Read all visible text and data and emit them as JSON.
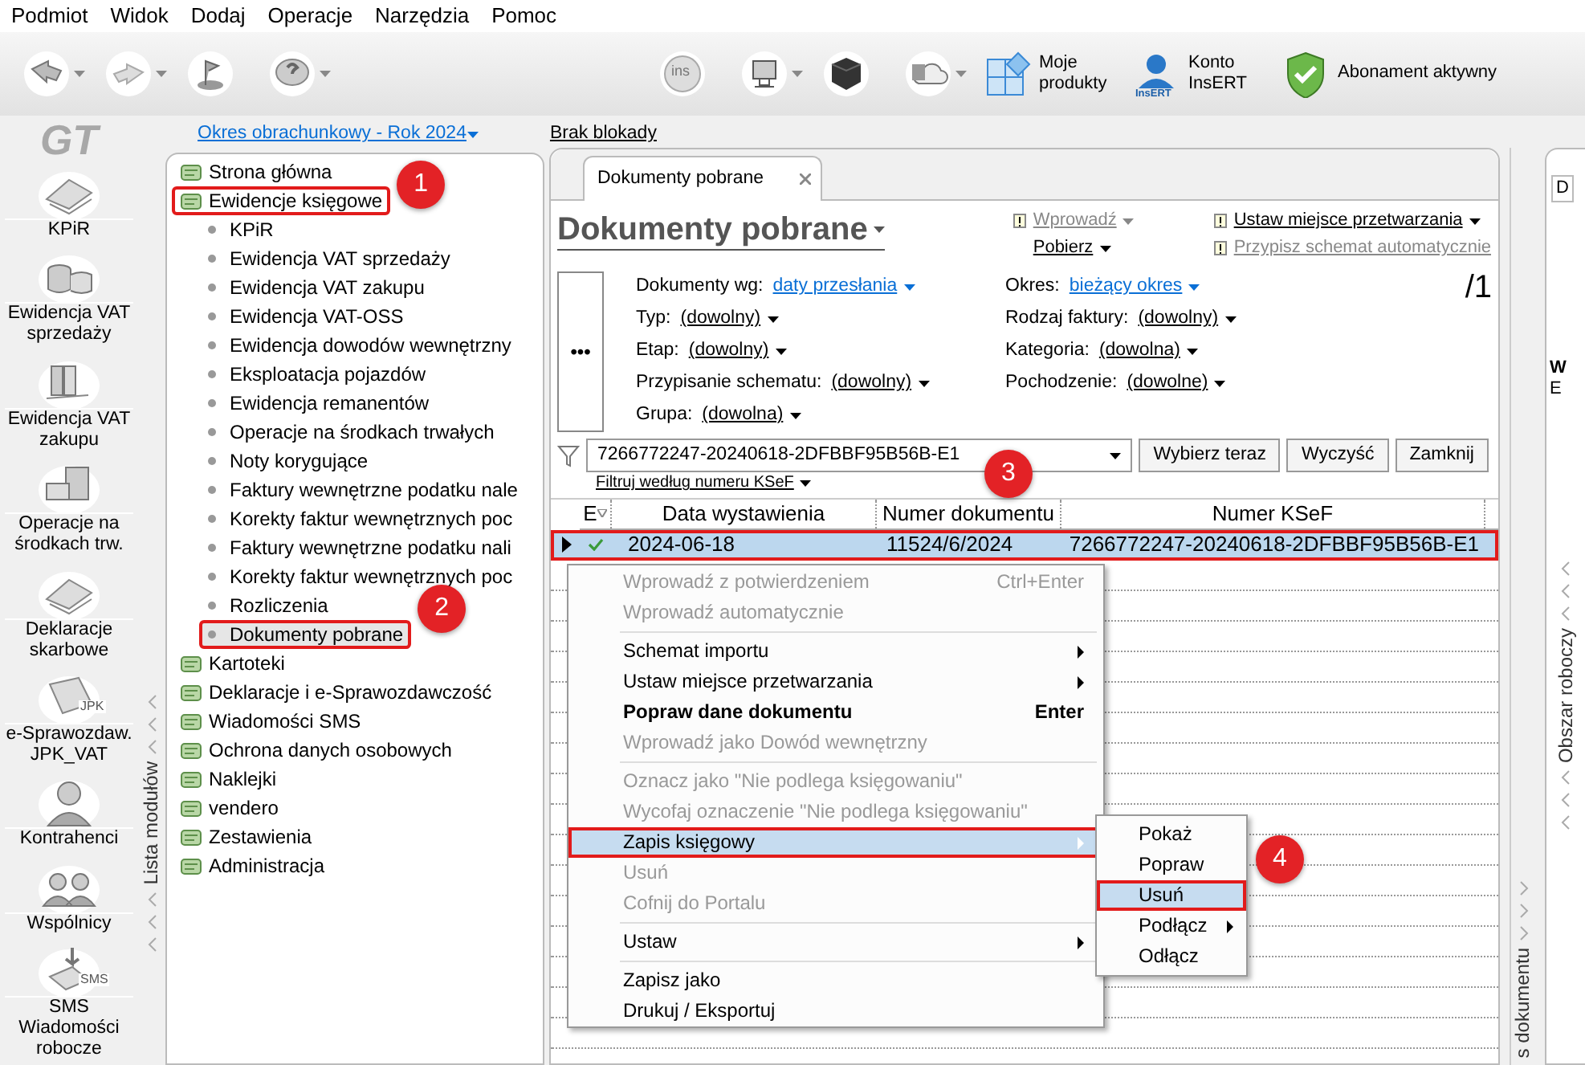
{
  "menu_bar": [
    {
      "label": "Podmiot"
    },
    {
      "label": "Widok"
    },
    {
      "label": "Dodaj"
    },
    {
      "label": "Operacje"
    },
    {
      "label": "Narzędzia"
    },
    {
      "label": "Pomoc"
    }
  ],
  "toolbar": {
    "buttons": [
      {
        "kind": "back",
        "has_menu": true
      },
      {
        "kind": "forward",
        "has_menu": true
      },
      {
        "kind": "flag",
        "has_menu": false
      },
      {
        "kind": "help",
        "has_menu": true
      },
      {
        "kind": "ins",
        "text": "ins",
        "has_menu": false
      },
      {
        "kind": "monitor",
        "has_menu": true
      },
      {
        "kind": "cube",
        "has_menu": false
      },
      {
        "kind": "cloud",
        "has_menu": true
      }
    ],
    "links": [
      {
        "kind": "products",
        "label": "Moje produkty"
      },
      {
        "kind": "account",
        "label": "Konto InsERT",
        "icon_text": "InsERT"
      },
      {
        "kind": "subscription",
        "label": "Abonament aktywny"
      }
    ]
  },
  "logo": "GT",
  "period": "Okres obrachunkowy - Rok 2024",
  "lock": "Brak blokady",
  "modules": [
    {
      "kind": "papers",
      "label": "KPiR"
    },
    {
      "kind": "coins",
      "label": "Ewidencja VAT sprzedaży"
    },
    {
      "kind": "binders",
      "label": "Ewidencja VAT zakupu"
    },
    {
      "kind": "cabinet",
      "label": "Operacje na środkach trw."
    },
    {
      "kind": "papers",
      "label": "Deklaracje skarbowe"
    },
    {
      "kind": "jpk",
      "label": "e-Sprawozdaw. JPK_VAT",
      "icon_text": "JPK"
    },
    {
      "kind": "person",
      "label": "Kontrahenci"
    },
    {
      "kind": "people",
      "label": "Wspólnicy"
    },
    {
      "kind": "sms",
      "label": "SMS Wiadomości robocze",
      "icon_text": "SMS"
    }
  ],
  "module_list_label": "Lista modułów",
  "tree": [
    {
      "label": "Strona główna",
      "selected": false,
      "highlighted": false
    },
    {
      "label": "Ewidencje księgowe",
      "selected": false,
      "highlighted": true,
      "callout": "1",
      "children": [
        {
          "label": "KPiR",
          "selected": false,
          "highlighted": false
        },
        {
          "label": "Ewidencja VAT sprzedaży",
          "selected": false,
          "highlighted": false
        },
        {
          "label": "Ewidencja VAT zakupu",
          "selected": false,
          "highlighted": false
        },
        {
          "label": "Ewidencja VAT-OSS",
          "selected": false,
          "highlighted": false
        },
        {
          "label": "Ewidencja dowodów wewnętrzny",
          "selected": false,
          "highlighted": false
        },
        {
          "label": "Eksploatacja pojazdów",
          "selected": false,
          "highlighted": false
        },
        {
          "label": "Ewidencja remanentów",
          "selected": false,
          "highlighted": false
        },
        {
          "label": "Operacje na środkach trwałych",
          "selected": false,
          "highlighted": false
        },
        {
          "label": "Noty korygujące",
          "selected": false,
          "highlighted": false
        },
        {
          "label": "Faktury wewnętrzne podatku nale",
          "selected": false,
          "highlighted": false
        },
        {
          "label": "Korekty faktur wewnętrznych poc",
          "selected": false,
          "highlighted": false
        },
        {
          "label": "Faktury wewnętrzne podatku nali",
          "selected": false,
          "highlighted": false
        },
        {
          "label": "Korekty faktur wewnętrznych poc",
          "selected": false,
          "highlighted": false
        },
        {
          "label": "Rozliczenia",
          "selected": false,
          "highlighted": false
        },
        {
          "label": "Dokumenty pobrane",
          "selected": true,
          "highlighted": true,
          "callout": "2"
        }
      ]
    },
    {
      "label": "Kartoteki",
      "selected": false,
      "highlighted": false
    },
    {
      "label": "Deklaracje i e-Sprawozdawczość",
      "selected": false,
      "highlighted": false
    },
    {
      "label": "Wiadomości SMS",
      "selected": false,
      "highlighted": false
    },
    {
      "label": "Ochrona danych osobowych",
      "selected": false,
      "highlighted": false
    },
    {
      "label": "Naklejki",
      "selected": false,
      "highlighted": false
    },
    {
      "label": "vendero",
      "selected": false,
      "highlighted": false
    },
    {
      "label": "Zestawienia",
      "selected": false,
      "highlighted": false
    },
    {
      "label": "Administracja",
      "selected": false,
      "highlighted": false
    }
  ],
  "tabs": [
    {
      "label": "Dokumenty pobrane",
      "selected": true
    }
  ],
  "page_title": "Dokumenty pobrane",
  "action_groups": [
    {
      "items": [
        {
          "label": "Wprowadź",
          "disabled": true
        },
        {
          "label": "Pobierz",
          "disabled": false
        }
      ]
    },
    {
      "items": [
        {
          "label": "Ustaw miejsce przetwarzania",
          "disabled": false
        },
        {
          "label": "Przypisz schemat automatycznie",
          "disabled": true
        }
      ]
    }
  ],
  "page_counter": "/1",
  "more_button": "•••",
  "filter_groups": [
    {
      "items": [
        {
          "label": "Dokumenty wg:",
          "value": "daty przesłania",
          "kind": "link"
        },
        {
          "label": "Typ:",
          "value": "(dowolny)",
          "kind": "plain"
        },
        {
          "label": "Etap:",
          "value": "(dowolny)",
          "kind": "plain"
        },
        {
          "label": "Przypisanie schematu:",
          "value": "(dowolny)",
          "kind": "plain"
        },
        {
          "label": "Grupa:",
          "value": "(dowolna)",
          "kind": "plain"
        }
      ]
    },
    {
      "items": [
        {
          "label": "Okres:",
          "value": "bieżący okres",
          "kind": "link"
        },
        {
          "label": "Rodzaj faktury:",
          "value": "(dowolny)",
          "kind": "plain"
        },
        {
          "label": "Kategoria:",
          "value": "(dowolna)",
          "kind": "plain"
        },
        {
          "label": "Pochodzenie:",
          "value": "(dowolne)",
          "kind": "plain"
        }
      ]
    }
  ],
  "search": {
    "value": "7266772247-20240618-2DFBBF95B56B-E1",
    "mode": "Filtruj według numeru KSeF",
    "buttons": [
      {
        "label": "Wybierz teraz"
      },
      {
        "label": "Wyczyść"
      },
      {
        "label": "Zamknij"
      }
    ]
  },
  "table": {
    "columns": [
      {
        "label": "E"
      },
      {
        "label": "Data wystawienia"
      },
      {
        "label": "Numer dokumentu",
        "callout": "3"
      },
      {
        "label": "Numer KSeF"
      }
    ],
    "rows": [
      {
        "selected": true,
        "highlighted": true,
        "posted": true,
        "cells": [
          "",
          "2024-06-18",
          "11524/6/2024",
          "7266772247-20240618-2DFBBF95B56B-E1"
        ]
      }
    ]
  },
  "context_menu": [
    {
      "kind": "item",
      "label": "Wprowadź z potwierdzeniem",
      "shortcut": "Ctrl+Enter",
      "disabled": true,
      "bold": false,
      "submenu": false,
      "selected": false,
      "highlighted": false
    },
    {
      "kind": "item",
      "label": "Wprowadź automatycznie",
      "disabled": true,
      "bold": false,
      "submenu": false,
      "selected": false,
      "highlighted": false
    },
    {
      "kind": "separator"
    },
    {
      "kind": "item",
      "label": "Schemat importu",
      "disabled": false,
      "bold": false,
      "submenu": true,
      "selected": false,
      "highlighted": false
    },
    {
      "kind": "item",
      "label": "Ustaw miejsce przetwarzania",
      "disabled": false,
      "bold": false,
      "submenu": true,
      "selected": false,
      "highlighted": false
    },
    {
      "kind": "item",
      "label": "Popraw dane dokumentu",
      "shortcut": "Enter",
      "disabled": false,
      "bold": true,
      "submenu": false,
      "selected": false,
      "highlighted": false
    },
    {
      "kind": "item",
      "label": "Wprowadź jako Dowód wewnętrzny",
      "disabled": true,
      "bold": false,
      "submenu": false,
      "selected": false,
      "highlighted": false
    },
    {
      "kind": "separator"
    },
    {
      "kind": "item",
      "label": "Oznacz jako \"Nie podlega księgowaniu\"",
      "disabled": true,
      "bold": false,
      "submenu": false,
      "selected": false,
      "highlighted": false
    },
    {
      "kind": "item",
      "label": "Wycofaj oznaczenie \"Nie podlega księgowaniu\"",
      "disabled": true,
      "bold": false,
      "submenu": false,
      "selected": false,
      "highlighted": false
    },
    {
      "kind": "item",
      "label": "Zapis księgowy",
      "disabled": false,
      "bold": false,
      "submenu": true,
      "selected": true,
      "highlighted": true,
      "children": [
        {
          "label": "Pokaż",
          "submenu": false,
          "selected": false,
          "highlighted": false
        },
        {
          "label": "Popraw",
          "submenu": false,
          "selected": false,
          "highlighted": false
        },
        {
          "label": "Usuń",
          "submenu": false,
          "selected": true,
          "highlighted": true,
          "callout": "4"
        },
        {
          "label": "Podłącz",
          "submenu": true,
          "selected": false,
          "highlighted": false
        },
        {
          "label": "Odłącz",
          "submenu": false,
          "selected": false,
          "highlighted": false
        }
      ]
    },
    {
      "kind": "item",
      "label": "Usuń",
      "disabled": true,
      "bold": false,
      "submenu": false,
      "selected": false,
      "highlighted": false
    },
    {
      "kind": "item",
      "label": "Cofnij do Portalu",
      "disabled": true,
      "bold": false,
      "submenu": false,
      "selected": false,
      "highlighted": false
    },
    {
      "kind": "separator"
    },
    {
      "kind": "item",
      "label": "Ustaw",
      "disabled": false,
      "bold": false,
      "submenu": true,
      "selected": false,
      "highlighted": false
    },
    {
      "kind": "separator"
    },
    {
      "kind": "item",
      "label": "Zapisz jako",
      "disabled": false,
      "bold": false,
      "submenu": false,
      "selected": false,
      "highlighted": false
    },
    {
      "kind": "item",
      "label": "Drukuj / Eksportuj",
      "disabled": false,
      "bold": false,
      "submenu": false,
      "selected": false,
      "highlighted": false
    }
  ],
  "document_strip_label": "s dokumentu",
  "right_panel": {
    "tab": "D",
    "text_1": "W",
    "text_2": "E",
    "label": "Obszar roboczy"
  }
}
